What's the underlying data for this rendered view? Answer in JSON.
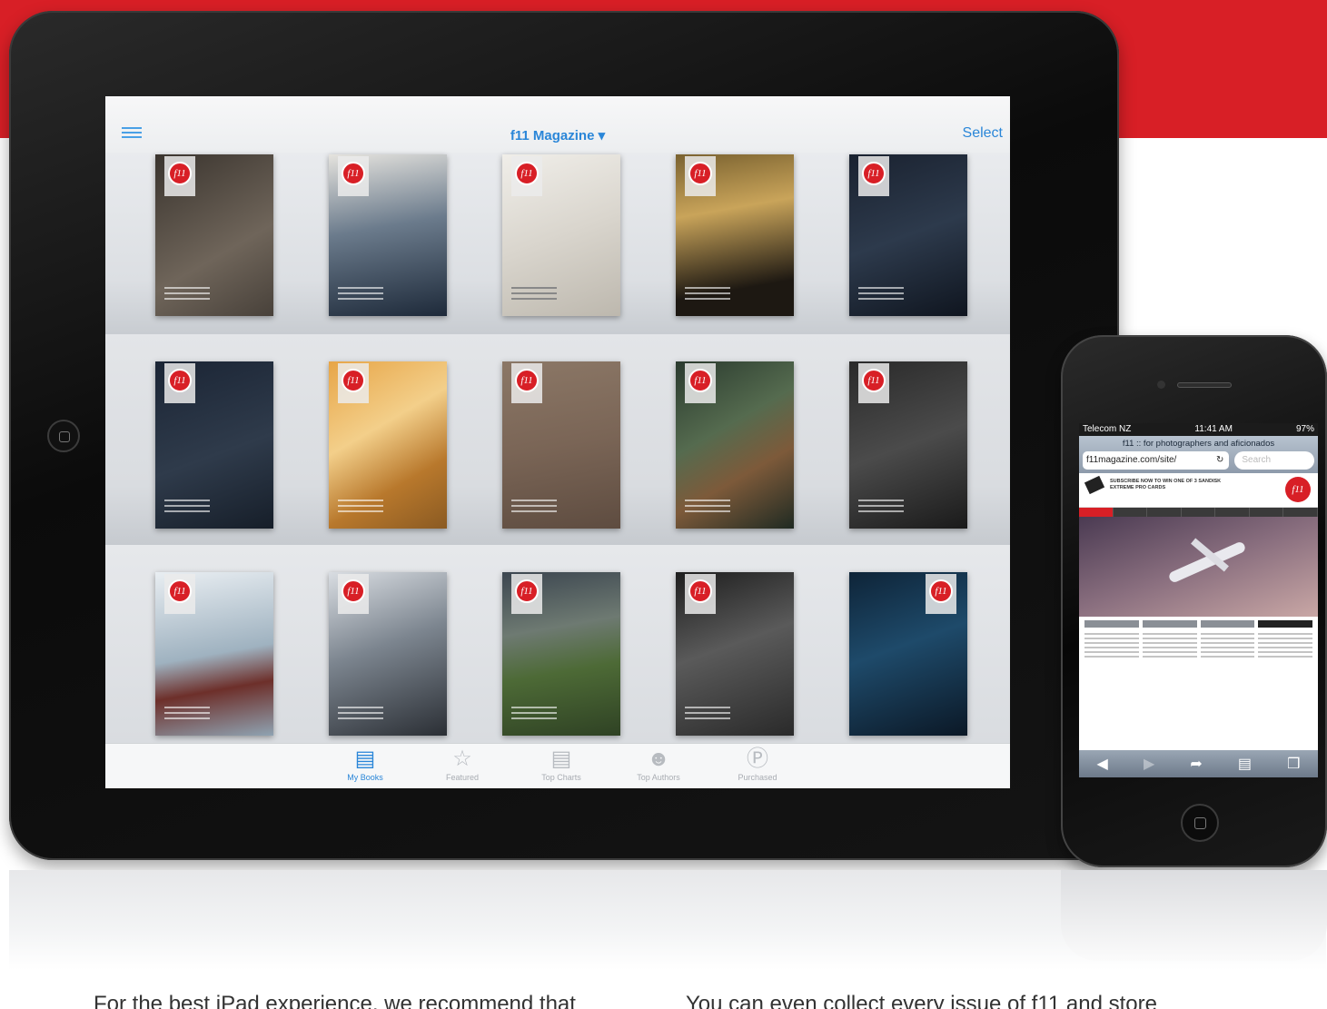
{
  "ipad": {
    "nav": {
      "menu_icon": "list-icon",
      "title": "f11 Magazine ▾",
      "select_label": "Select"
    },
    "cover_logo_text": "f11",
    "tabs": [
      {
        "label": "My Books",
        "icon": "open-book-icon",
        "active": true
      },
      {
        "label": "Featured",
        "icon": "star-icon",
        "active": false
      },
      {
        "label": "Top Charts",
        "icon": "list-icon",
        "active": false
      },
      {
        "label": "Top Authors",
        "icon": "people-icon",
        "active": false
      },
      {
        "label": "Purchased",
        "icon": "purchased-icon",
        "active": false
      }
    ]
  },
  "iphone": {
    "status": {
      "carrier": "Telecom NZ",
      "time": "11:41 AM",
      "battery": "97%"
    },
    "page_title": "f11 :: for photographers and aficionados",
    "url": "f11magazine.com/site/",
    "search_placeholder": "Search",
    "promo": "SUBSCRIBE NOW TO WIN ONE OF 3 SANDISK EXTREME PRO CARDS",
    "site_logo": "f11"
  },
  "body_text": {
    "left": "For the best iPad experience, we recommend that",
    "right": "You can even collect every issue of f11 and store"
  },
  "colors": {
    "brand_red": "#d81f26",
    "ios_blue": "#2a86d8"
  }
}
